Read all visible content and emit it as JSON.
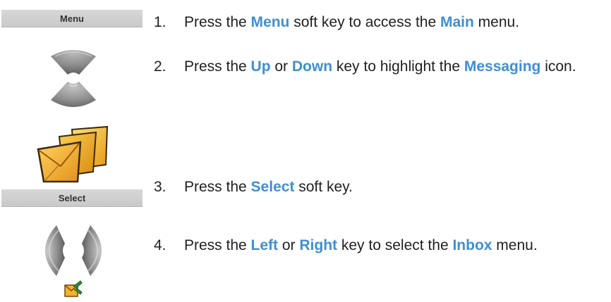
{
  "softkeys": {
    "menu": "Menu",
    "select": "Select"
  },
  "steps": [
    {
      "num": "1.",
      "p1": "Press the ",
      "k1": "Menu",
      "p2": " soft key to access the ",
      "k2": "Main",
      "p3": " menu."
    },
    {
      "num": "2.",
      "p1": "Press the ",
      "k1": "Up",
      "p2": " or ",
      "k2": "Down",
      "p3": " key to highlight the ",
      "k3": "Messaging",
      "p4": " icon."
    },
    {
      "num": "3.",
      "p1": "Press the ",
      "k1": "Select",
      "p2": " soft key."
    },
    {
      "num": "4.",
      "p1": "Press the ",
      "k1": "Left",
      "p2": " or ",
      "k2": "Right",
      "p3": " key to select the ",
      "k3": "Inbox",
      "p4": " menu."
    }
  ],
  "icons": {
    "up_key": "up-arrow-key-icon",
    "down_key": "down-arrow-key-icon",
    "messaging": "messaging-folder-icon",
    "left_right_keys": "left-right-arrow-keys-icon",
    "inbox": "inbox-envelope-icon"
  },
  "colors": {
    "keyword": "#3f8fd2",
    "softkey_bg": "#d0d0d0",
    "text": "#1f1f1f"
  }
}
